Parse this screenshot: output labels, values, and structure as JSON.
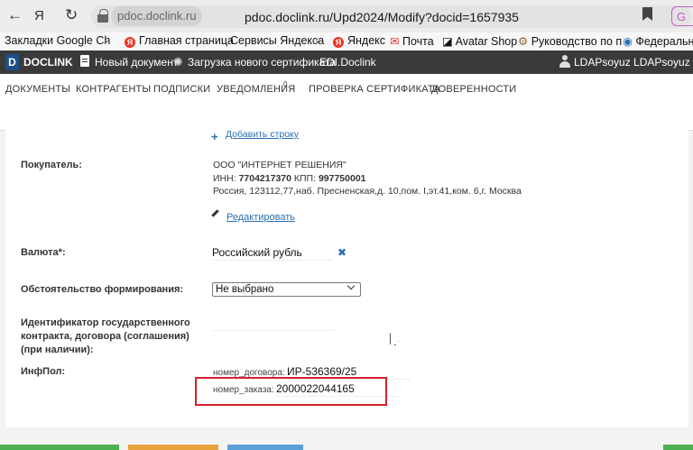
{
  "browser": {
    "host": "pdoc.doclink.ru",
    "url": "pdoc.doclink.ru/Upd2024/Modify?docid=1657935",
    "ext_label": "G"
  },
  "bookmarks": [
    {
      "label": "Закладки Google Ch"
    },
    {
      "label": "Главная страница"
    },
    {
      "label": "Сервисы Яндекса"
    },
    {
      "label": "Яндекс"
    },
    {
      "label": "Почта"
    },
    {
      "label": "Avatar Shop"
    },
    {
      "label": "Руководство по п"
    },
    {
      "label": "Федеральная"
    }
  ],
  "appbar": {
    "logo_letter": "D",
    "brand": "DOCLINK",
    "new_doc": "Новый документ",
    "upload_cert": "Загрузка нового сертификата",
    "edi": "EDI.Doclink",
    "user": "LDAPsoyuz LDAPsoyuz [LDAP"
  },
  "mainnav": {
    "documents": "ДОКУМЕНТЫ",
    "counterparties": "КОНТРАГЕНТЫ",
    "signatures": "ПОДПИСКИ",
    "notifications": "УВЕДОМЛЕНИЯ",
    "notifications_count": "0",
    "cert_check": "ПРОВЕРКА СЕРТИФИКАТА",
    "powers": "ДОВЕРЕННОСТИ"
  },
  "form": {
    "add_row": "Добавить строку",
    "buyer_label": "Покупатель:",
    "buyer_name": "ООО \"ИНТЕРНЕТ РЕШЕНИЯ\"",
    "buyer_inn_prefix": "ИНН:",
    "buyer_inn": "7704217370",
    "buyer_kpp_prefix": "КПП:",
    "buyer_kpp": "997750001",
    "buyer_address": "Россия, 123112,77,наб. Пресненская,д. 10,пом. I,эт.41,ком. 6,г. Москва",
    "edit": "Редактировать",
    "currency_label": "Валюта*:",
    "currency_value": "Российский рубль",
    "circumstance_label": "Обстоятельство формирования:",
    "circumstance_value": "Не выбрано",
    "gov_id_label_1": "Идентификатор государственного",
    "gov_id_label_2": "контракта, договора (соглашения)",
    "gov_id_label_3": "(при наличии):",
    "gov_id_value": "",
    "infpol_label": "ИнфПол:",
    "contract_key": "номер_договора:",
    "contract_value": "ИР-536369/25",
    "order_key": "номер_заказа:",
    "order_value": "2000022044165"
  },
  "colors": {
    "highlight": "#d8212b",
    "link": "#2a6fb0",
    "appbar": "#3a3a3a"
  }
}
